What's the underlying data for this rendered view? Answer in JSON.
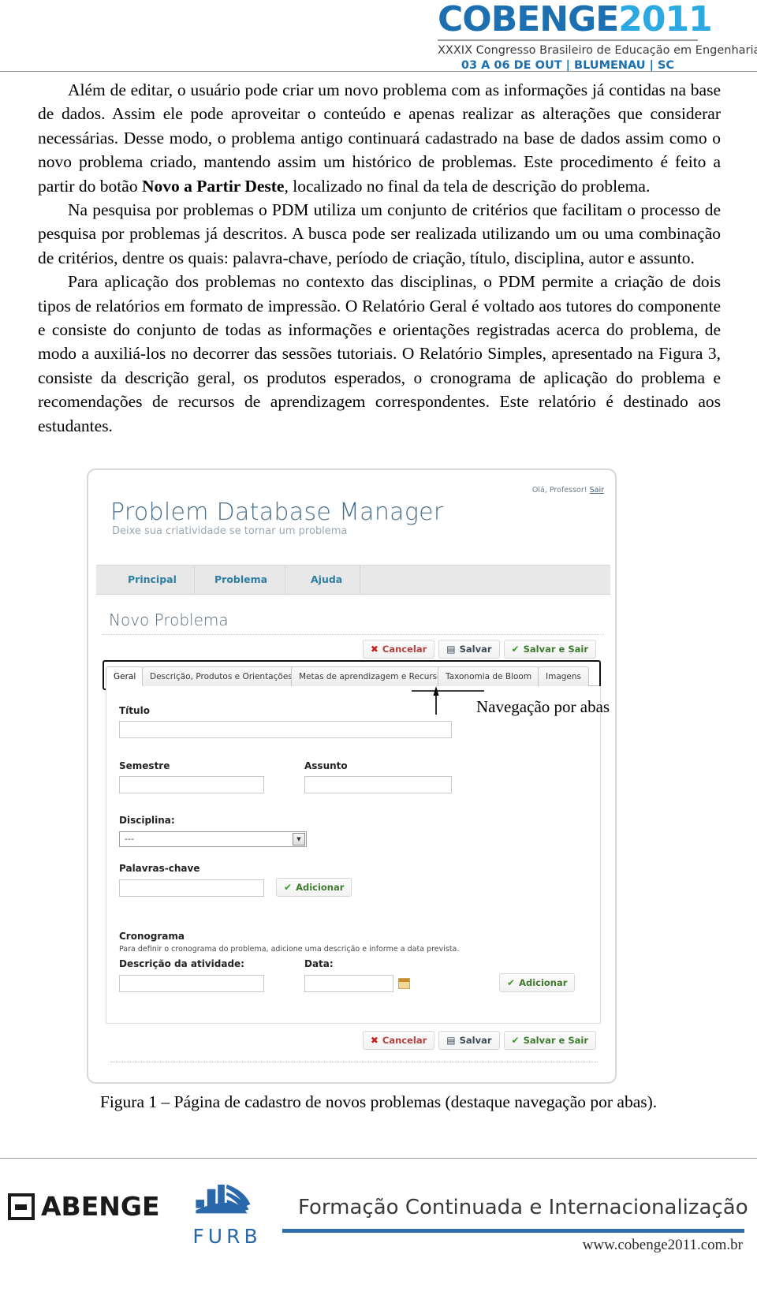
{
  "header": {
    "wordmark_main": "COBENGE",
    "wordmark_year": "2011",
    "congress_line": "XXXIX Congresso Brasileiro de Educação em Engenharia",
    "date_line": "03 A 06 DE OUT  |  BLUMENAU  |  SC",
    "brand_blue": "#1c6fb0",
    "brand_light_blue": "#2ba9e0"
  },
  "body": {
    "p1_a": "Além de editar, o usuário pode criar um novo problema com as informações já contidas na base de dados. Assim ele pode aproveitar o conteúdo e apenas realizar as alterações que considerar necessárias. Desse modo, o problema antigo continuará cadastrado na base de dados assim como o novo problema criado, mantendo assim um histórico de problemas. Este procedimento é feito a partir do botão ",
    "p1_bold": "Novo a Partir Deste",
    "p1_b": ", localizado no final da tela de descrição do problema.",
    "p2": "Na pesquisa por problemas o PDM utiliza um conjunto de critérios que facilitam o processo de pesquisa por problemas já descritos. A busca pode ser realizada utilizando um ou uma combinação de critérios, dentre os quais: palavra-chave, período de criação, título, disciplina, autor e assunto.",
    "p3": "Para aplicação dos problemas no contexto das disciplinas, o PDM permite a criação de dois tipos de relatórios em formato de impressão. O Relatório Geral é voltado aos tutores do componente e consiste do conjunto de todas as informações e orientações registradas acerca do problema, de modo a auxiliá-los no decorrer das sessões tutoriais. O Relatório Simples, apresentado na Figura 3, consiste da descrição geral, os produtos esperados, o cronograma de aplicação do problema e recomendações de recursos de aprendizagem correspondentes. Este relatório é destinado aos estudantes."
  },
  "app": {
    "greeting": "Olá, Professor!",
    "logout_label": "Sair",
    "title": "Problem Database Manager",
    "subtitle": "Deixe sua criatividade se tornar um problema",
    "nav": [
      {
        "label": "Principal"
      },
      {
        "label": "Problema"
      },
      {
        "label": "Ajuda"
      }
    ],
    "page_heading": "Novo Problema",
    "toolbar": {
      "cancel_label": "Cancelar",
      "cancel_glyph": "✖",
      "save_label": "Salvar",
      "save_glyph": "▤",
      "save_exit_label": "Salvar e Sair",
      "save_exit_glyph": "✔"
    },
    "tabs": [
      {
        "label": "Geral",
        "active": true
      },
      {
        "label": "Descrição, Produtos e Orientações",
        "active": false
      },
      {
        "label": "Metas de aprendizagem e Recursos",
        "active": false
      },
      {
        "label": "Taxonomia de Bloom",
        "active": false
      },
      {
        "label": "Imagens",
        "active": false
      }
    ],
    "form": {
      "titulo_label": "Título",
      "titulo_value": "",
      "semestre_label": "Semestre",
      "semestre_value": "",
      "assunto_label": "Assunto",
      "assunto_value": "",
      "disciplina_label": "Disciplina:",
      "disciplina_value": "---",
      "palavras_label": "Palavras-chave",
      "palavras_value": "",
      "add_keyword_label": "Adicionar",
      "add_keyword_glyph": "✔",
      "cronograma_label": "Cronograma",
      "cronograma_help": "Para definir o cronograma do problema, adicione uma descrição e informe a data prevista.",
      "atividade_label": "Descrição da atividade:",
      "atividade_value": "",
      "data_label": "Data:",
      "data_value": "",
      "add_schedule_label": "Adicionar",
      "add_schedule_glyph": "✔"
    }
  },
  "annotation": {
    "callout_label": "Navegação por abas"
  },
  "figure": {
    "caption": "Figura 1 – Página de cadastro de novos problemas (destaque navegação por abas)."
  },
  "footer": {
    "abenge_label": "ABENGE",
    "furb_label": "FURB",
    "slogan": "Formação Continuada e Internacionalização",
    "url": "www.cobenge2011.com.br",
    "bar_color": "#2f6ea8"
  }
}
